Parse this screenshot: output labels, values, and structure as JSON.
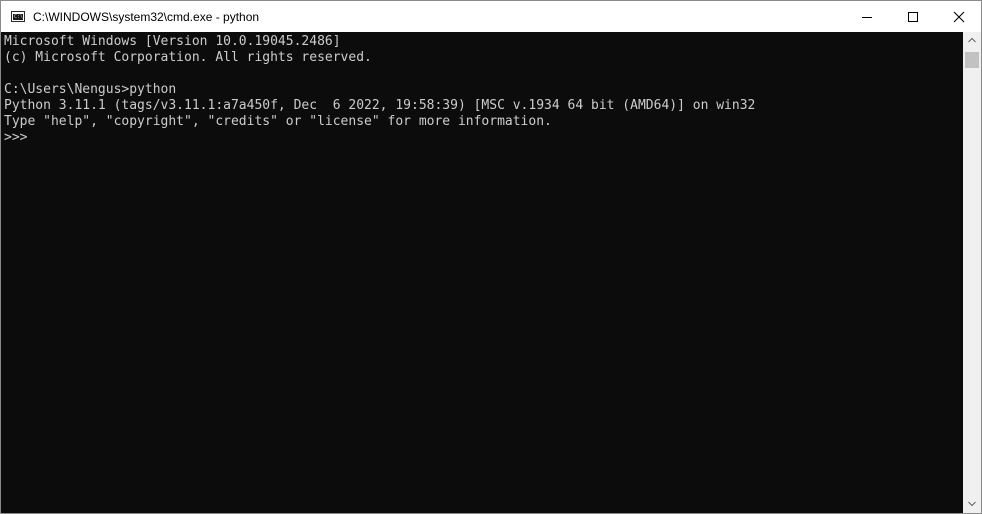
{
  "window": {
    "title": "C:\\WINDOWS\\system32\\cmd.exe - python",
    "icon": "cmd-icon",
    "icon_glyph": "C:\\",
    "controls": [
      "minimize-icon",
      "maximize-icon",
      "close-icon"
    ]
  },
  "console": {
    "lines": [
      "Microsoft Windows [Version 10.0.19045.2486]",
      "(c) Microsoft Corporation. All rights reserved.",
      "",
      "C:\\Users\\Nengus>python",
      "Python 3.11.1 (tags/v3.11.1:a7a450f, Dec  6 2022, 19:58:39) [MSC v.1934 64 bit (AMD64)] on win32",
      "Type \"help\", \"copyright\", \"credits\" or \"license\" for more information.",
      ">>> "
    ],
    "colors": {
      "background": "#0c0c0c",
      "foreground": "#cccccc"
    }
  },
  "scrollbar": {
    "position": 0
  }
}
